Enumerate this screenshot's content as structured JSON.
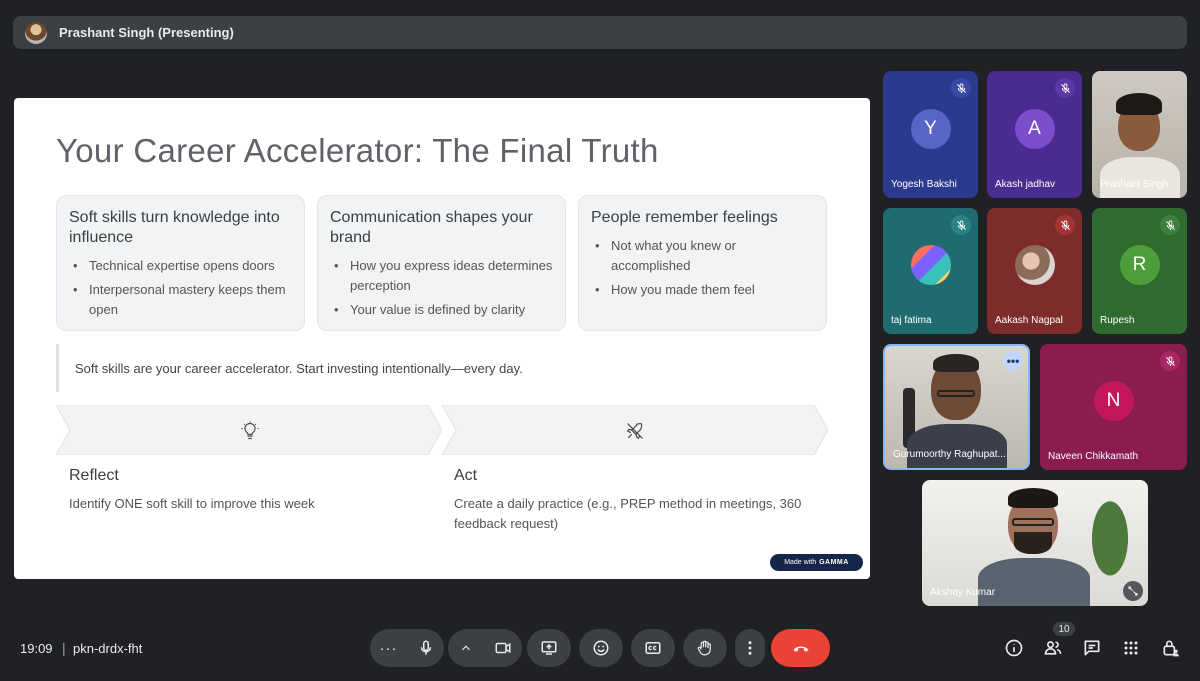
{
  "presenter": {
    "label": "Prashant Singh (Presenting)"
  },
  "slide": {
    "title": "Your Career Accelerator: The Final Truth",
    "cards": [
      {
        "title": "Soft skills turn knowledge into influence",
        "bullets": [
          "Technical expertise opens doors",
          "Interpersonal mastery keeps them open"
        ]
      },
      {
        "title": "Communication shapes your brand",
        "bullets": [
          "How you express ideas determines perception",
          "Your value is defined by clarity"
        ]
      },
      {
        "title": "People remember feelings",
        "bullets": [
          "Not what you knew or accomplished",
          "How you made them feel"
        ]
      }
    ],
    "quote": "Soft skills are your career accelerator. Start investing intentionally—every day.",
    "steps": [
      {
        "icon": "lightbulb-icon",
        "title": "Reflect",
        "desc": "Identify ONE soft skill to improve this week"
      },
      {
        "icon": "rocket-icon",
        "title": "Act",
        "desc": "Create a daily practice (e.g., PREP method in meetings, 360 feedback request)"
      }
    ],
    "badge_made": "Made with",
    "badge_brand": "GAMMA"
  },
  "participants": [
    {
      "name": "Yogesh Bakshi",
      "initial": "Y",
      "muted": true,
      "bg": "#2b3a8c",
      "avatar_bg": "#5865c6"
    },
    {
      "name": "Akash jadhav",
      "initial": "A",
      "muted": true,
      "bg": "#4a2c91",
      "avatar_bg": "#7c4dcc"
    },
    {
      "name": "Prashant Singh",
      "muted": false
    },
    {
      "name": "taj fatima",
      "muted": true,
      "bg": "#1f6b6e"
    },
    {
      "name": "Aakash Nagpal",
      "muted": true,
      "bg": "#7d2b2b"
    },
    {
      "name": "Rupesh",
      "initial": "R",
      "muted": true,
      "bg": "#2f6b2f",
      "avatar_bg": "#4f9e3c"
    },
    {
      "name": "Gurumoorthy Raghupat...",
      "muted": false,
      "more": "•••"
    },
    {
      "name": "Naveen Chikkamath",
      "initial": "N",
      "muted": true,
      "bg": "#8b1c50",
      "avatar_bg": "#c2185b"
    },
    {
      "name": "Akshay Kumar",
      "muted": false
    }
  ],
  "meeting": {
    "time": "19:09",
    "separator": "|",
    "code": "pkn-drdx-fht"
  },
  "people_count": "10",
  "colors": {
    "background": "#202124",
    "control": "#3c4043",
    "end_call": "#ea4335",
    "accent_blue": "#8ab4f8"
  }
}
